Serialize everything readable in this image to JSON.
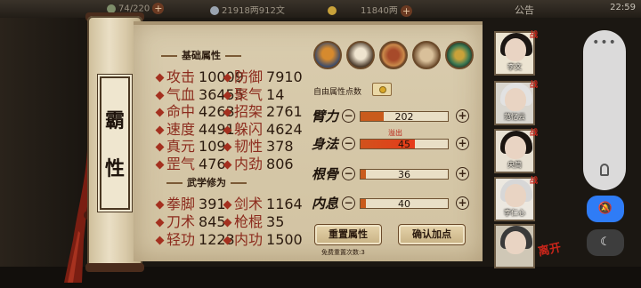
{
  "topbar": {
    "stamina": "74/220",
    "silver": "21918两912文",
    "gold": "11840两",
    "notice": "公告",
    "time": "22:59",
    "colors": {
      "silver": "#9aa4b0",
      "gold": "#c9a23a"
    }
  },
  "scroll_title": [
    "霸",
    "性"
  ],
  "basic_attrs": {
    "title": "基础属性",
    "stats": [
      {
        "label": "攻击",
        "value": "10009"
      },
      {
        "label": "防御",
        "value": "7910"
      },
      {
        "label": "气血",
        "value": "36455"
      },
      {
        "label": "聚气",
        "value": "14"
      },
      {
        "label": "命中",
        "value": "4263"
      },
      {
        "label": "招架",
        "value": "2761"
      },
      {
        "label": "速度",
        "value": "4491"
      },
      {
        "label": "躲闪",
        "value": "4624"
      },
      {
        "label": "真元",
        "value": "109"
      },
      {
        "label": "韧性",
        "value": "378"
      },
      {
        "label": "罡气",
        "value": "476"
      },
      {
        "label": "内劲",
        "value": "806"
      }
    ]
  },
  "martial": {
    "title": "武学修为",
    "stats": [
      {
        "label": "拳脚",
        "value": "391"
      },
      {
        "label": "剑术",
        "value": "1164"
      },
      {
        "label": "刀术",
        "value": "845"
      },
      {
        "label": "枪棍",
        "value": "35"
      },
      {
        "label": "轻功",
        "value": "1223"
      },
      {
        "label": "内功",
        "value": "1500"
      }
    ]
  },
  "skill_icons": [
    "straw-hat-icon",
    "scholar-icon",
    "drum-icon",
    "hammer-fist-icon",
    "jade-disc-icon"
  ],
  "free_points_label": "自由属性点数",
  "overflow_label": "溢出",
  "attributes": [
    {
      "name": "臂力",
      "value": "202",
      "fill": 0.27,
      "overflow": false
    },
    {
      "name": "身法",
      "value": "45",
      "fill": 0.62,
      "overflow": true
    },
    {
      "name": "根骨",
      "value": "36",
      "fill": 0.06,
      "overflow": false
    },
    {
      "name": "内息",
      "value": "40",
      "fill": 0.06,
      "overflow": false
    }
  ],
  "buttons": {
    "minus": "⊖",
    "plus": "⊕",
    "reset": "重置属性",
    "confirm": "确认加点"
  },
  "reset_note": "免费重置次数:3",
  "portraits": [
    {
      "name": "李文",
      "battle": "战",
      "hair": "#1b1613",
      "bg": "#ece4d2"
    },
    {
      "name": "范忆云",
      "battle": "战",
      "hair": "#e2e2e2",
      "bg": "#d9d6cf"
    },
    {
      "name": "央简",
      "battle": "战",
      "hair": "#1a1410",
      "bg": "#e8e1d3"
    },
    {
      "name": "李仁心",
      "battle": "战",
      "hair": "#d7d7d7",
      "bg": "#ece8e0"
    },
    {
      "name": "",
      "battle": "",
      "hair": "#3a3a3a",
      "bg": "#cfc7b6"
    }
  ],
  "leave_label": "离开",
  "side_panel": {
    "dots": "•••",
    "mute_icon": "bell-slash-icon",
    "night_icon": "moon-icon"
  }
}
